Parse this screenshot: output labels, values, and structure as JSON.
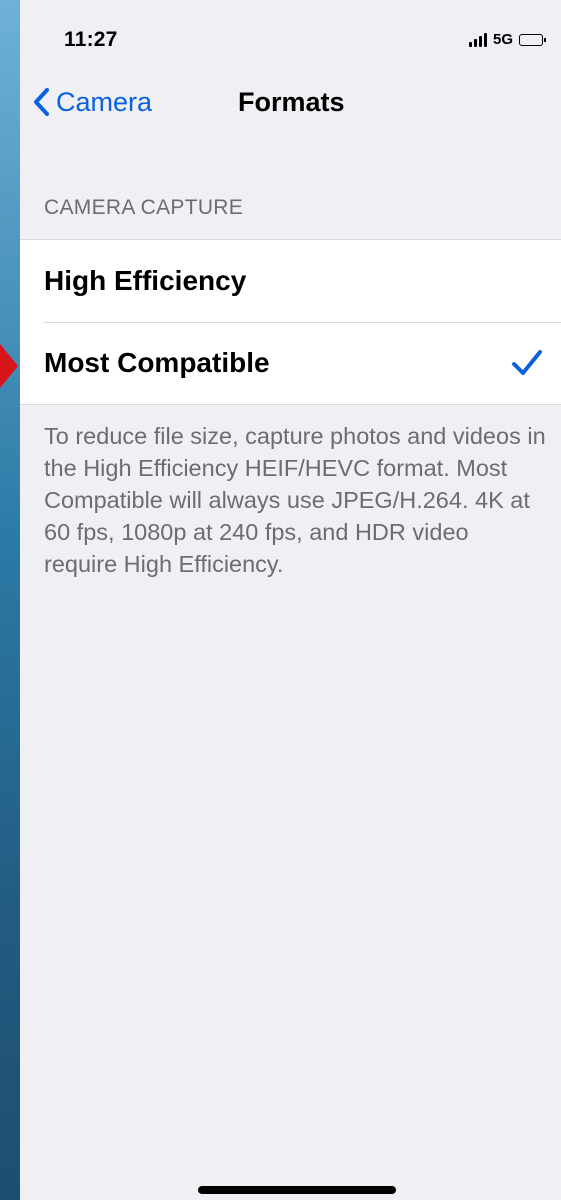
{
  "status_bar": {
    "time": "11:27",
    "network": "5G",
    "signal_icon": "signal-bars-icon",
    "battery_icon": "battery-icon"
  },
  "nav": {
    "back_label": "Camera",
    "back_icon": "chevron-left-icon",
    "title": "Formats"
  },
  "camera_capture": {
    "header": "CAMERA CAPTURE",
    "options": [
      {
        "label": "High Efficiency",
        "selected": false
      },
      {
        "label": "Most Compatible",
        "selected": true
      }
    ],
    "check_icon": "checkmark-icon",
    "footer": "To reduce file size, capture photos and videos in the High Efficiency HEIF/HEVC format. Most Compatible will always use JPEG/H.264. 4K at 60 fps, 1080p at 240 fps, and HDR video require High Efficiency."
  },
  "colors": {
    "accent": "#0a62e0",
    "background": "#efeff4",
    "secondary_text": "#6c6c71",
    "annotation_arrow": "#d8141b"
  }
}
